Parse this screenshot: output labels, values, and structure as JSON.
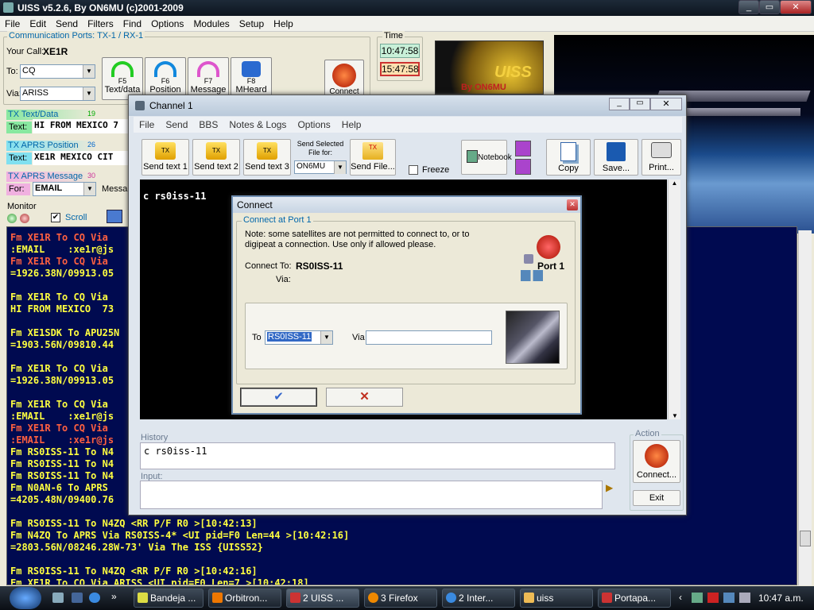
{
  "main": {
    "title": "UISS v5.2.6, By ON6MU (c)2001-2009",
    "menu": [
      "File",
      "Edit",
      "Send",
      "Filters",
      "Find",
      "Options",
      "Modules",
      "Setup",
      "Help"
    ],
    "comm_ports_label": "Communication Ports: TX-1 / RX-1",
    "your_call_label": "Your Call:",
    "your_call": "XE1R",
    "to_label": "To:",
    "to_value": "CQ",
    "via_label": "Via:",
    "via_value": "ARISS",
    "time_label": "Time",
    "time_local": "10:47:58",
    "time_utc": "15:47:58",
    "logo_text": "UISS",
    "logo_byline": "By ON6MU",
    "buttons": {
      "f5": "F5",
      "f6": "F6",
      "f7": "F7",
      "f8": "F8",
      "text_data": "Text/data",
      "position": "Position",
      "message": "Message",
      "mheard": "MHeard",
      "connect": "Connect"
    },
    "tx_text_label": "TX Text/Data",
    "tx_text_count": "19",
    "text_label": "Text:",
    "tx_text_value": "HI FROM MEXICO  7",
    "tx_aprs_pos_label": "TX APRS Position",
    "tx_aprs_pos_count": "26",
    "tx_aprs_pos_value": "XE1R  MEXICO CIT",
    "tx_aprs_msg_label": "TX APRS Message",
    "tx_aprs_msg_count": "30",
    "for_label": "For:",
    "for_value": "EMAIL",
    "message_label": "Messa",
    "monitor_label": "Monitor",
    "scroll_label": "Scroll"
  },
  "monitor_lines": [
    {
      "text": "Fm XE1R To CQ Via",
      "color": "#ff6040"
    },
    {
      "text": ":EMAIL    :xe1r@js",
      "color": "#ffff40"
    },
    {
      "text": "Fm XE1R To CQ Via",
      "color": "#ff6040"
    },
    {
      "text": "=1926.38N/09913.05",
      "color": "#ffff40"
    },
    {
      "text": "",
      "color": "#ffff40"
    },
    {
      "text": "Fm XE1R To CQ Via",
      "color": "#ffff40"
    },
    {
      "text": "HI FROM MEXICO  73",
      "color": "#ffff40"
    },
    {
      "text": "",
      "color": "#ffff40"
    },
    {
      "text": "Fm XE1SDK To APU25N",
      "color": "#ffff40"
    },
    {
      "text": "=1903.56N/09810.44",
      "color": "#ffff40"
    },
    {
      "text": "",
      "color": "#ffff40"
    },
    {
      "text": "Fm XE1R To CQ Via",
      "color": "#ffff40"
    },
    {
      "text": "=1926.38N/09913.05",
      "color": "#ffff40"
    },
    {
      "text": "",
      "color": "#ffff40"
    },
    {
      "text": "Fm XE1R To CQ Via",
      "color": "#ffff40"
    },
    {
      "text": ":EMAIL    :xe1r@js",
      "color": "#ffff40"
    },
    {
      "text": "Fm XE1R To CQ Via",
      "color": "#ff6040"
    },
    {
      "text": ":EMAIL    :xe1r@js",
      "color": "#ff6040"
    },
    {
      "text": "Fm RS0ISS-11 To N4",
      "color": "#ffff40"
    },
    {
      "text": "Fm RS0ISS-11 To N4",
      "color": "#ffff40"
    },
    {
      "text": "Fm RS0ISS-11 To N4",
      "color": "#ffff40"
    },
    {
      "text": "Fm N0AN-6 To APRS",
      "color": "#ffff40"
    },
    {
      "text": "=4205.48N/09400.76",
      "color": "#ffff40"
    },
    {
      "text": "",
      "color": "#ffff40"
    },
    {
      "text": "Fm RS0ISS-11 To N4ZQ <RR P/F R0 >[10:42:13]",
      "color": "#ffff40"
    },
    {
      "text": "Fm N4ZQ To APRS Via RS0ISS-4* <UI pid=F0 Len=44 >[10:42:16]",
      "color": "#ffff40"
    },
    {
      "text": "=2803.56N/08246.28W-73' Via The ISS {UISS52}",
      "color": "#ffff40"
    },
    {
      "text": "",
      "color": "#ffff40"
    },
    {
      "text": "Fm RS0ISS-11 To N4ZQ <RR P/F R0 >[10:42:16]",
      "color": "#ffff40"
    },
    {
      "text": "Fm XE1R To CQ Via ARISS <UI pid=F0 Len=7 >[10:42:18]",
      "color": "#ffff40"
    }
  ],
  "channel": {
    "title": "Channel 1",
    "menu": [
      "File",
      "Send",
      "BBS",
      "Notes & Logs",
      "Options",
      "Help"
    ],
    "send_text_1": "Send text 1",
    "send_text_2": "Send text 2",
    "send_text_3": "Send text 3",
    "send_selected_label": "Send Selected File for:",
    "send_selected_value": "ON6MU",
    "send_file": "Send File...",
    "freeze": "Freeze",
    "notebook": "Notebook",
    "copy": "Copy",
    "save": "Save...",
    "print": "Print...",
    "terminal_text": "c rs0iss-11",
    "history_label": "History",
    "history_text": "c rs0iss-11",
    "input_label": "Input:",
    "action_label": "Action",
    "connect_btn": "Connect...",
    "exit_btn": "Exit",
    "tx_tags": [
      "TX",
      "TX",
      "TX",
      "TX"
    ]
  },
  "dialog": {
    "title": "Connect",
    "group_label": "Connect at Port 1",
    "note": "Note: some satellites are not permitted to connect to, or to digipeat a connection. Use only if allowed please.",
    "connect_to_label": "Connect To:",
    "connect_to_value": "RS0ISS-11",
    "via_label": "Via:",
    "port_label": "Port 1",
    "to_label": "To",
    "to_value": "RS0ISS-11",
    "via_field_label": "Via",
    "via_field_value": "",
    "ok_glyph": "✔",
    "cancel_glyph": "✕"
  },
  "taskbar": {
    "items": [
      "Bandeja ...",
      "Orbitron...",
      "2 UISS ...",
      "3 Firefox",
      "2 Inter...",
      "uiss",
      "Portapa..."
    ],
    "clock": "10:47 a.m."
  },
  "colors": {
    "monitor_bg": "#000a50",
    "accent": "#06a",
    "tx_green": "#88e8a0",
    "tx_cyan": "#80e0f0",
    "tx_pink": "#f0b0e0"
  }
}
